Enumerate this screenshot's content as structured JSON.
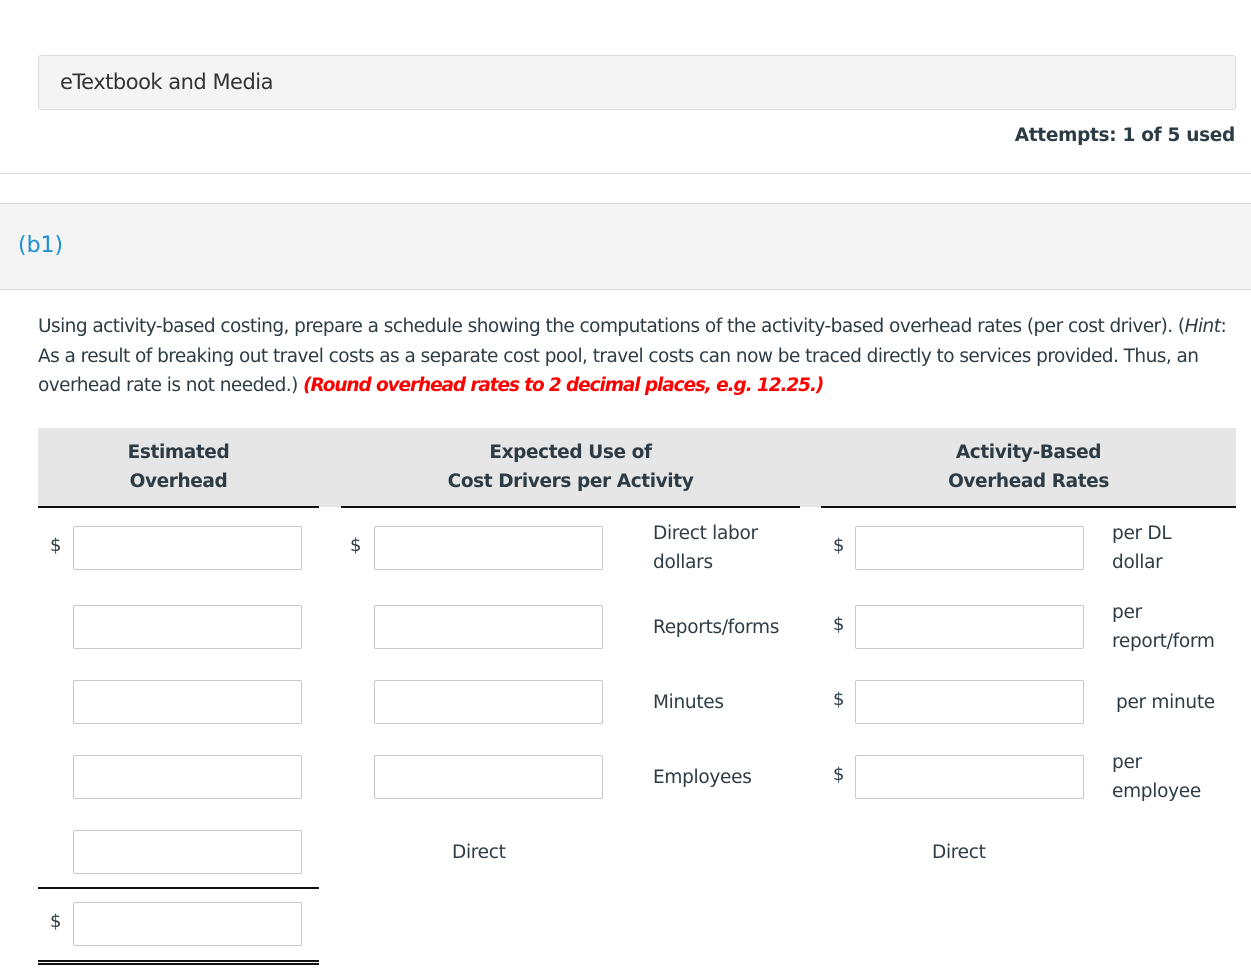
{
  "etextbook": {
    "label": "eTextbook and Media"
  },
  "attempts": {
    "text": "Attempts: 1 of 5 used"
  },
  "part": {
    "label": "(b1)"
  },
  "instructions": {
    "text1": "Using activity-based costing, prepare a schedule showing the computations of the activity-based overhead rates (per cost driver). (",
    "hint": "Hint",
    "text2": ": As a result of breaking out travel costs as a separate cost pool, travel costs can now be traced directly to services provided. Thus, an overhead rate is not needed.) ",
    "rounding": "(Round overhead rates to 2 decimal places, e.g. 12.25.)"
  },
  "table": {
    "headers": {
      "estimated_overhead": [
        "Estimated",
        "Overhead"
      ],
      "expected_use": [
        "Expected Use of",
        "Cost Drivers per Activity"
      ],
      "rates": [
        "Activity-Based",
        "Overhead Rates"
      ]
    },
    "currency_symbol": "$",
    "rows": [
      {
        "overhead_value": "",
        "driver_value": "",
        "driver_label": "Direct labor dollars",
        "rate_value": "",
        "rate_unit": "per DL dollar"
      },
      {
        "overhead_value": "",
        "driver_value": "",
        "driver_label": "Reports/forms",
        "rate_value": "",
        "rate_unit": "per report/form"
      },
      {
        "overhead_value": "",
        "driver_value": "",
        "driver_label": "Minutes",
        "rate_value": "",
        "rate_unit": "per minute"
      },
      {
        "overhead_value": "",
        "driver_value": "",
        "driver_label": "Employees",
        "rate_value": "",
        "rate_unit": "per employee"
      },
      {
        "overhead_value": "",
        "driver_label": "Direct",
        "rate_label": "Direct"
      }
    ],
    "total_value": ""
  }
}
